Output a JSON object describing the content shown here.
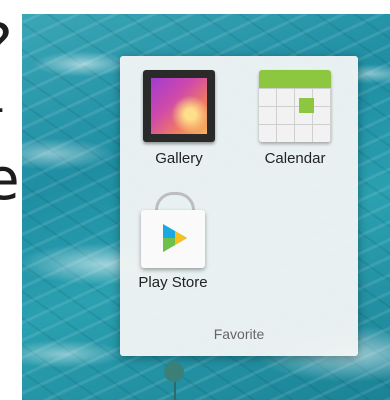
{
  "left_glyphs": [
    "?",
    "-",
    "e"
  ],
  "folder": {
    "name": "Favorite",
    "apps": [
      {
        "label": "Gallery",
        "icon": "gallery-icon"
      },
      {
        "label": "Calendar",
        "icon": "calendar-icon"
      },
      {
        "label": "Play Store",
        "icon": "play-store-icon"
      }
    ]
  },
  "colors": {
    "wallpaper": "#1f8ea3",
    "folder_bg": "#f0f4f4",
    "calendar_accent": "#8dc63f",
    "play_blue": "#19a9e0"
  }
}
